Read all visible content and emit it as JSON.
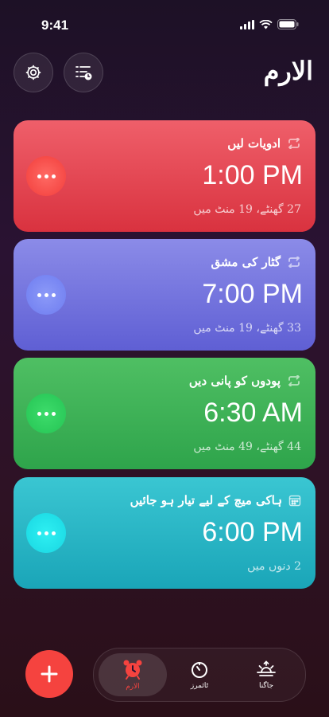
{
  "status_bar": {
    "time": "9:41"
  },
  "header": {
    "title": "الارم"
  },
  "alarms": [
    {
      "name": "ادویات لیں",
      "time": "1:00 PM",
      "remaining": "27 گھنٹے، 19 منٹ میں",
      "repeat_icon": "repeat-icon"
    },
    {
      "name": "گٹار کی مشق",
      "time": "7:00 PM",
      "remaining": "33 گھنٹے، 19 منٹ میں",
      "repeat_icon": "repeat-icon"
    },
    {
      "name": "پودوں کو پانی دیں",
      "time": "6:30 AM",
      "remaining": "44 گھنٹے، 49 منٹ میں",
      "repeat_icon": "repeat-icon"
    },
    {
      "name": "ہاکی میچ کے لیے تیار ہو جائیں",
      "time": "6:00 PM",
      "remaining": "2 دنوں میں",
      "repeat_icon": "calendar-icon"
    }
  ],
  "tabs": [
    {
      "label": "الارم"
    },
    {
      "label": "ٹائمرز"
    },
    {
      "label": "جاگنا"
    }
  ],
  "colors": {
    "active_tab": "#f5433f",
    "add_button": "#f5433f"
  }
}
